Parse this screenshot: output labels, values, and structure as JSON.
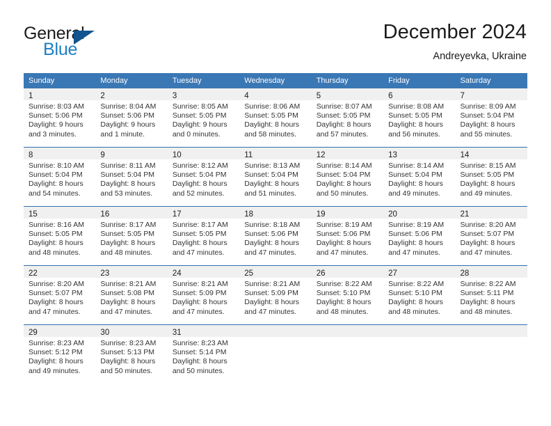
{
  "brand": {
    "line1": "General",
    "line2": "Blue",
    "logo_icon": "triangle-icon",
    "color_dark": "#1c1c1c",
    "color_blue": "#1d7fc3",
    "color_triangle": "#12548f"
  },
  "header": {
    "title": "December 2024",
    "subtitle": "Andreyevka, Ukraine"
  },
  "theme": {
    "header_row_bg": "#3a77b5",
    "row_separator": "#2f6fae",
    "daynum_band_bg": "#f0f0f0",
    "cell_bg": "#ffffff",
    "text": "#333333"
  },
  "weekday_headers": [
    "Sunday",
    "Monday",
    "Tuesday",
    "Wednesday",
    "Thursday",
    "Friday",
    "Saturday"
  ],
  "weeks": [
    [
      {
        "day": "1",
        "sunrise": "Sunrise: 8:03 AM",
        "sunset": "Sunset: 5:06 PM",
        "daylight1": "Daylight: 9 hours",
        "daylight2": "and 3 minutes."
      },
      {
        "day": "2",
        "sunrise": "Sunrise: 8:04 AM",
        "sunset": "Sunset: 5:06 PM",
        "daylight1": "Daylight: 9 hours",
        "daylight2": "and 1 minute."
      },
      {
        "day": "3",
        "sunrise": "Sunrise: 8:05 AM",
        "sunset": "Sunset: 5:05 PM",
        "daylight1": "Daylight: 9 hours",
        "daylight2": "and 0 minutes."
      },
      {
        "day": "4",
        "sunrise": "Sunrise: 8:06 AM",
        "sunset": "Sunset: 5:05 PM",
        "daylight1": "Daylight: 8 hours",
        "daylight2": "and 58 minutes."
      },
      {
        "day": "5",
        "sunrise": "Sunrise: 8:07 AM",
        "sunset": "Sunset: 5:05 PM",
        "daylight1": "Daylight: 8 hours",
        "daylight2": "and 57 minutes."
      },
      {
        "day": "6",
        "sunrise": "Sunrise: 8:08 AM",
        "sunset": "Sunset: 5:05 PM",
        "daylight1": "Daylight: 8 hours",
        "daylight2": "and 56 minutes."
      },
      {
        "day": "7",
        "sunrise": "Sunrise: 8:09 AM",
        "sunset": "Sunset: 5:04 PM",
        "daylight1": "Daylight: 8 hours",
        "daylight2": "and 55 minutes."
      }
    ],
    [
      {
        "day": "8",
        "sunrise": "Sunrise: 8:10 AM",
        "sunset": "Sunset: 5:04 PM",
        "daylight1": "Daylight: 8 hours",
        "daylight2": "and 54 minutes."
      },
      {
        "day": "9",
        "sunrise": "Sunrise: 8:11 AM",
        "sunset": "Sunset: 5:04 PM",
        "daylight1": "Daylight: 8 hours",
        "daylight2": "and 53 minutes."
      },
      {
        "day": "10",
        "sunrise": "Sunrise: 8:12 AM",
        "sunset": "Sunset: 5:04 PM",
        "daylight1": "Daylight: 8 hours",
        "daylight2": "and 52 minutes."
      },
      {
        "day": "11",
        "sunrise": "Sunrise: 8:13 AM",
        "sunset": "Sunset: 5:04 PM",
        "daylight1": "Daylight: 8 hours",
        "daylight2": "and 51 minutes."
      },
      {
        "day": "12",
        "sunrise": "Sunrise: 8:14 AM",
        "sunset": "Sunset: 5:04 PM",
        "daylight1": "Daylight: 8 hours",
        "daylight2": "and 50 minutes."
      },
      {
        "day": "13",
        "sunrise": "Sunrise: 8:14 AM",
        "sunset": "Sunset: 5:04 PM",
        "daylight1": "Daylight: 8 hours",
        "daylight2": "and 49 minutes."
      },
      {
        "day": "14",
        "sunrise": "Sunrise: 8:15 AM",
        "sunset": "Sunset: 5:05 PM",
        "daylight1": "Daylight: 8 hours",
        "daylight2": "and 49 minutes."
      }
    ],
    [
      {
        "day": "15",
        "sunrise": "Sunrise: 8:16 AM",
        "sunset": "Sunset: 5:05 PM",
        "daylight1": "Daylight: 8 hours",
        "daylight2": "and 48 minutes."
      },
      {
        "day": "16",
        "sunrise": "Sunrise: 8:17 AM",
        "sunset": "Sunset: 5:05 PM",
        "daylight1": "Daylight: 8 hours",
        "daylight2": "and 48 minutes."
      },
      {
        "day": "17",
        "sunrise": "Sunrise: 8:17 AM",
        "sunset": "Sunset: 5:05 PM",
        "daylight1": "Daylight: 8 hours",
        "daylight2": "and 47 minutes."
      },
      {
        "day": "18",
        "sunrise": "Sunrise: 8:18 AM",
        "sunset": "Sunset: 5:06 PM",
        "daylight1": "Daylight: 8 hours",
        "daylight2": "and 47 minutes."
      },
      {
        "day": "19",
        "sunrise": "Sunrise: 8:19 AM",
        "sunset": "Sunset: 5:06 PM",
        "daylight1": "Daylight: 8 hours",
        "daylight2": "and 47 minutes."
      },
      {
        "day": "20",
        "sunrise": "Sunrise: 8:19 AM",
        "sunset": "Sunset: 5:06 PM",
        "daylight1": "Daylight: 8 hours",
        "daylight2": "and 47 minutes."
      },
      {
        "day": "21",
        "sunrise": "Sunrise: 8:20 AM",
        "sunset": "Sunset: 5:07 PM",
        "daylight1": "Daylight: 8 hours",
        "daylight2": "and 47 minutes."
      }
    ],
    [
      {
        "day": "22",
        "sunrise": "Sunrise: 8:20 AM",
        "sunset": "Sunset: 5:07 PM",
        "daylight1": "Daylight: 8 hours",
        "daylight2": "and 47 minutes."
      },
      {
        "day": "23",
        "sunrise": "Sunrise: 8:21 AM",
        "sunset": "Sunset: 5:08 PM",
        "daylight1": "Daylight: 8 hours",
        "daylight2": "and 47 minutes."
      },
      {
        "day": "24",
        "sunrise": "Sunrise: 8:21 AM",
        "sunset": "Sunset: 5:09 PM",
        "daylight1": "Daylight: 8 hours",
        "daylight2": "and 47 minutes."
      },
      {
        "day": "25",
        "sunrise": "Sunrise: 8:21 AM",
        "sunset": "Sunset: 5:09 PM",
        "daylight1": "Daylight: 8 hours",
        "daylight2": "and 47 minutes."
      },
      {
        "day": "26",
        "sunrise": "Sunrise: 8:22 AM",
        "sunset": "Sunset: 5:10 PM",
        "daylight1": "Daylight: 8 hours",
        "daylight2": "and 48 minutes."
      },
      {
        "day": "27",
        "sunrise": "Sunrise: 8:22 AM",
        "sunset": "Sunset: 5:10 PM",
        "daylight1": "Daylight: 8 hours",
        "daylight2": "and 48 minutes."
      },
      {
        "day": "28",
        "sunrise": "Sunrise: 8:22 AM",
        "sunset": "Sunset: 5:11 PM",
        "daylight1": "Daylight: 8 hours",
        "daylight2": "and 48 minutes."
      }
    ],
    [
      {
        "day": "29",
        "sunrise": "Sunrise: 8:23 AM",
        "sunset": "Sunset: 5:12 PM",
        "daylight1": "Daylight: 8 hours",
        "daylight2": "and 49 minutes."
      },
      {
        "day": "30",
        "sunrise": "Sunrise: 8:23 AM",
        "sunset": "Sunset: 5:13 PM",
        "daylight1": "Daylight: 8 hours",
        "daylight2": "and 50 minutes."
      },
      {
        "day": "31",
        "sunrise": "Sunrise: 8:23 AM",
        "sunset": "Sunset: 5:14 PM",
        "daylight1": "Daylight: 8 hours",
        "daylight2": "and 50 minutes."
      },
      {
        "day": "",
        "sunrise": "",
        "sunset": "",
        "daylight1": "",
        "daylight2": ""
      },
      {
        "day": "",
        "sunrise": "",
        "sunset": "",
        "daylight1": "",
        "daylight2": ""
      },
      {
        "day": "",
        "sunrise": "",
        "sunset": "",
        "daylight1": "",
        "daylight2": ""
      },
      {
        "day": "",
        "sunrise": "",
        "sunset": "",
        "daylight1": "",
        "daylight2": ""
      }
    ]
  ]
}
